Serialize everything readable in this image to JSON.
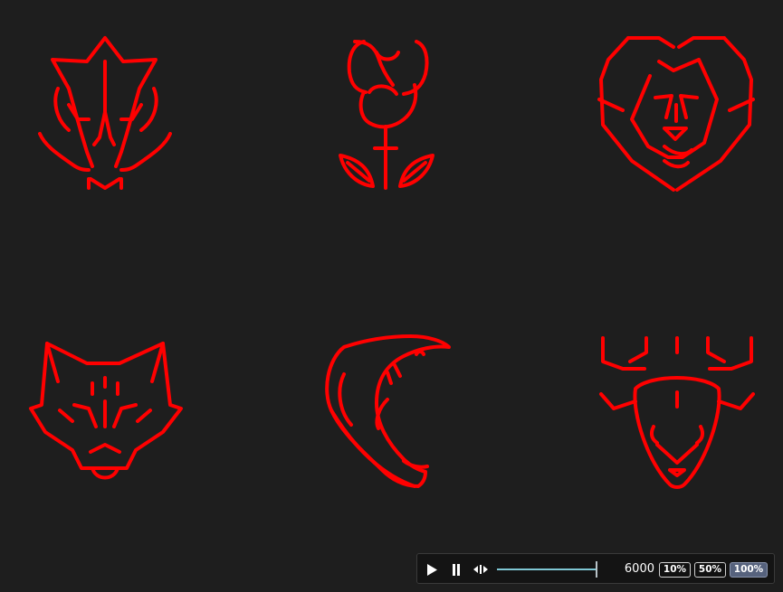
{
  "icons": [
    {
      "name": "dragon"
    },
    {
      "name": "rose"
    },
    {
      "name": "lion"
    },
    {
      "name": "wolf"
    },
    {
      "name": "fish"
    },
    {
      "name": "deer"
    }
  ],
  "stroke_color": "#ff0000",
  "background_color": "#1e1e1e",
  "player": {
    "play_icon": "play-icon",
    "pause_icon": "pause-icon",
    "scrub_icon": "scrub-icon",
    "progress": 1.0,
    "time_value": "6000",
    "speeds": [
      "10%",
      "50%",
      "100%"
    ],
    "active_speed": "100%"
  }
}
